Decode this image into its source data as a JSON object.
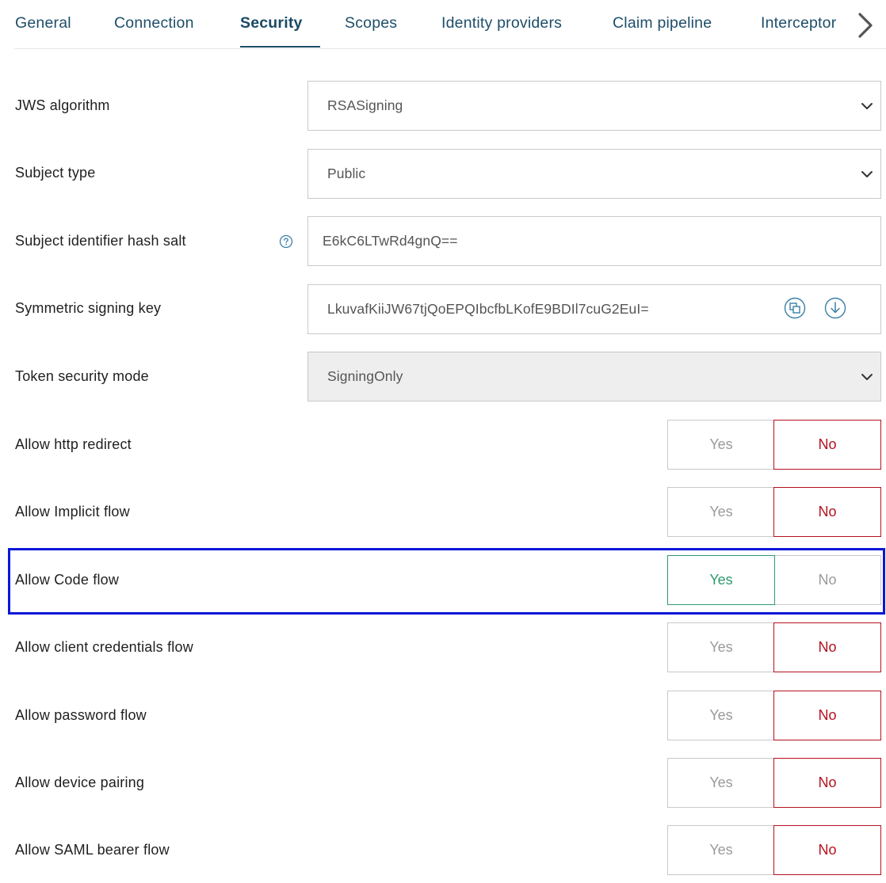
{
  "tabs": [
    {
      "label": "General"
    },
    {
      "label": "Connection"
    },
    {
      "label": "Security"
    },
    {
      "label": "Scopes"
    },
    {
      "label": "Identity providers"
    },
    {
      "label": "Claim pipeline"
    },
    {
      "label": "Interceptor"
    }
  ],
  "active_tab": "Security",
  "icons": {
    "next_tab": "chevron-right-icon",
    "help": "question-circle-icon",
    "copy": "copy-icon",
    "download": "download-icon",
    "dropdown": "chevron-down-icon"
  },
  "colors": {
    "tab_text": "#1e4e6a",
    "no_selected": "#b3121f",
    "yes_selected": "#2e9a6f",
    "highlight": "#0a18d6"
  },
  "fields": {
    "jws_algorithm": {
      "label": "JWS algorithm",
      "value": "RSASigning"
    },
    "subject_type": {
      "label": "Subject type",
      "value": "Public"
    },
    "hash_salt": {
      "label": "Subject identifier hash salt",
      "value": "E6kC6LTwRd4gnQ=="
    },
    "signing_key": {
      "label": "Symmetric signing key",
      "value": "LkuvafKiiJW67tjQoEPQIbcfbLKofE9BDIl7cuG2EuI="
    },
    "token_security_mode": {
      "label": "Token security mode",
      "value": "SigningOnly"
    }
  },
  "toggle_labels": {
    "yes": "Yes",
    "no": "No"
  },
  "toggles": [
    {
      "label": "Allow http redirect",
      "selected": "No"
    },
    {
      "label": "Allow Implicit flow",
      "selected": "No"
    },
    {
      "label": "Allow Code flow",
      "selected": "Yes"
    },
    {
      "label": "Allow client credentials flow",
      "selected": "No"
    },
    {
      "label": "Allow password flow",
      "selected": "No"
    },
    {
      "label": "Allow device pairing",
      "selected": "No"
    },
    {
      "label": "Allow SAML bearer flow",
      "selected": "No"
    }
  ]
}
